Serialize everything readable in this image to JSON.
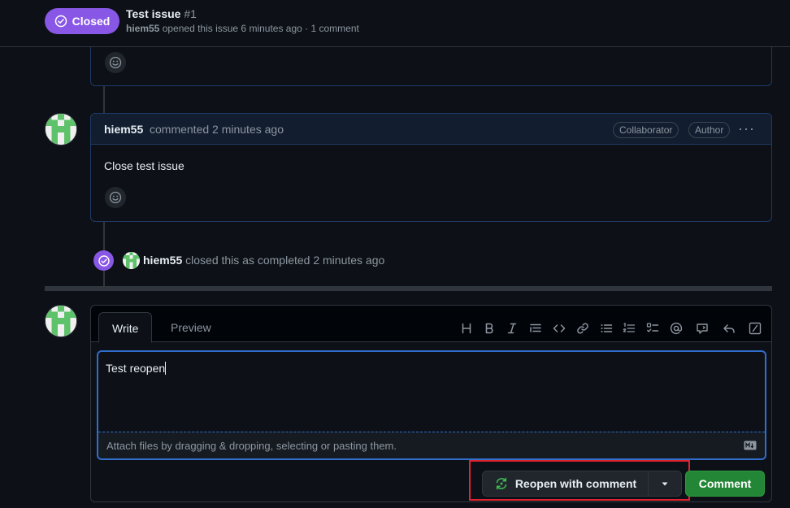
{
  "header": {
    "state": "Closed",
    "title": "Test issue",
    "number": "#1",
    "author": "hiem55",
    "meta": "opened this issue 6 minutes ago · 1 comment"
  },
  "comment": {
    "author": "hiem55",
    "time": "commented 2 minutes ago",
    "badges": [
      "Collaborator",
      "Author"
    ],
    "body": "Close test issue"
  },
  "event": {
    "author": "hiem55",
    "text": "closed this as completed 2 minutes ago"
  },
  "editor": {
    "tabs": [
      "Write",
      "Preview"
    ],
    "toolbar": [
      "heading-icon",
      "bold-icon",
      "italic-icon",
      "quote-icon",
      "code-icon",
      "link-icon",
      "unordered-list-icon",
      "ordered-list-icon",
      "task-list-icon",
      "mention-icon",
      "reference-icon",
      "saved-reply-icon",
      "slash-commands-icon"
    ],
    "value": "Test reopen",
    "attach_hint": "Attach files by dragging & dropping, selecting or pasting them."
  },
  "actions": {
    "reopen_label": "Reopen with comment",
    "comment_label": "Comment"
  },
  "colors": {
    "closed_purple": "#8957e5",
    "primary_green": "#238636",
    "focus_blue": "#316dca",
    "highlight_red": "#e0242f"
  }
}
